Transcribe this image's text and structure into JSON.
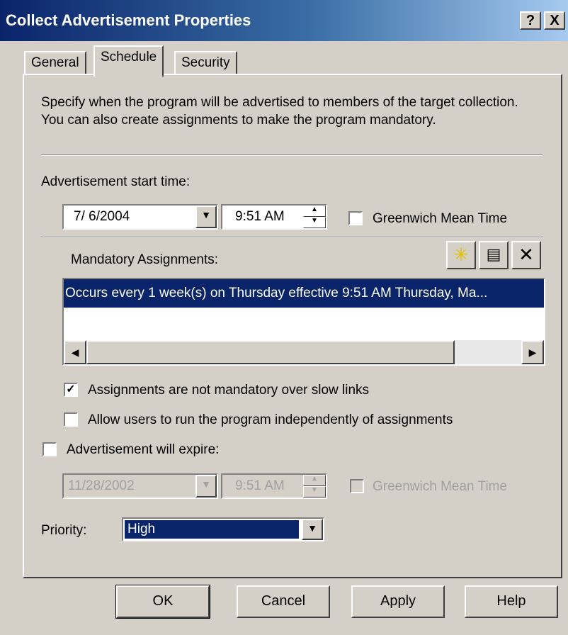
{
  "window": {
    "title": "Collect Advertisement Properties",
    "help_glyph": "?",
    "close_glyph": "X"
  },
  "tabs": [
    {
      "label": "General"
    },
    {
      "label": "Schedule"
    },
    {
      "label": "Security"
    }
  ],
  "schedule": {
    "description": "Specify when the program will be advertised to members of the target collection. You can also create assignments to make the program mandatory.",
    "start_time_label": "Advertisement start time:",
    "start_date": "7/ 6/2004",
    "start_time": "9:51 AM",
    "gmt_label": "Greenwich Mean Time",
    "mandatory_label": "Mandatory Assignments:",
    "assignments": [
      "Occurs every 1 week(s) on Thursday effective 9:51 AM Thursday, Ma..."
    ],
    "not_mandatory_label": "Assignments are not mandatory over slow links",
    "not_mandatory_checked": true,
    "allow_users_label": "Allow users to run the program independently of assignments",
    "allow_users_checked": false,
    "expire_label": "Advertisement will expire:",
    "expire_checked": false,
    "expire_date": "11/28/2002",
    "expire_time": "9:51 AM",
    "expire_gmt_label": "Greenwich Mean Time",
    "priority_label": "Priority:",
    "priority_value": "High"
  },
  "buttons": {
    "ok": "OK",
    "cancel": "Cancel",
    "apply": "Apply",
    "help": "Help"
  },
  "icons": {
    "new": "new-star-icon",
    "properties": "properties-icon",
    "delete": "delete-x-icon"
  },
  "colors": {
    "selection": "#0a246a",
    "titlebar_start": "#0a246a",
    "dialog_bg": "#d4d0c8"
  }
}
